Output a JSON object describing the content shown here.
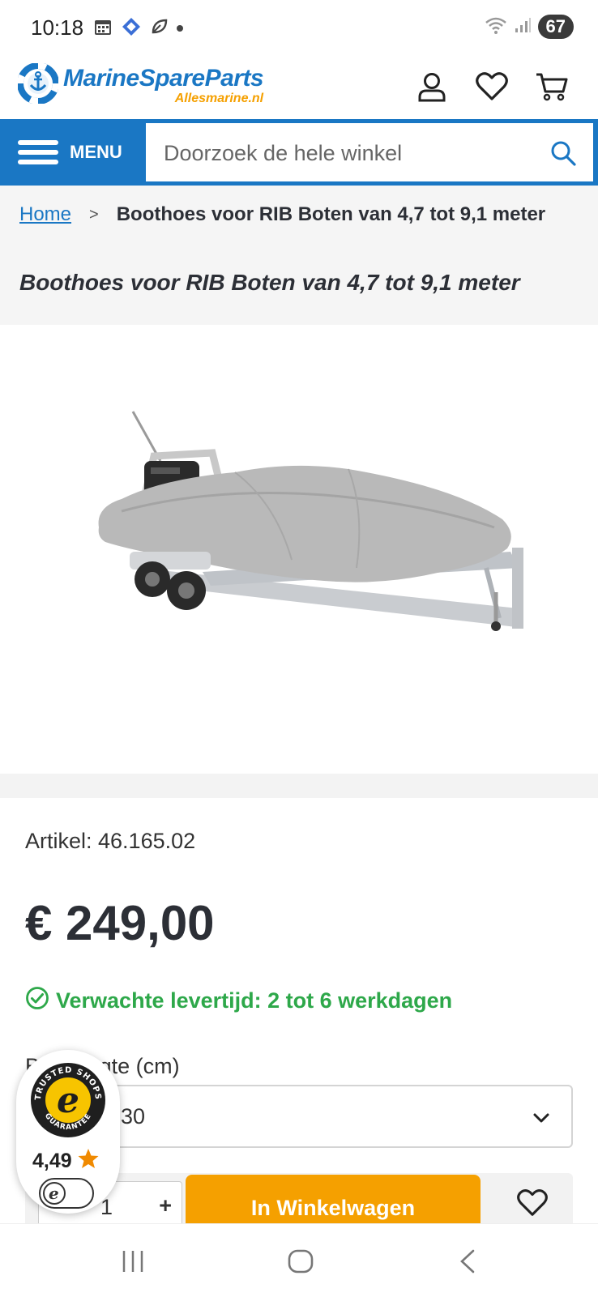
{
  "status_bar": {
    "time": "10:18",
    "battery": "67",
    "icons": [
      "calendar-icon",
      "puzzle-icon",
      "leaf-icon",
      "dot-icon",
      "wifi-icon",
      "signal-icon"
    ]
  },
  "header": {
    "logo_main": "MarineSpareParts",
    "logo_sub": "Allesmarine.nl",
    "icons": [
      "account-icon",
      "wishlist-icon",
      "cart-icon"
    ]
  },
  "nav": {
    "menu_label": "MENU",
    "search_placeholder": "Doorzoek de hele winkel"
  },
  "breadcrumb": {
    "home": "Home",
    "separator": ">",
    "current": "Boothoes voor RIB Boten van 4,7 tot 9,1 meter"
  },
  "product": {
    "title": "Boothoes voor RIB Boten van 4,7 tot 9,1 meter",
    "sku": "Artikel: 46.165.02",
    "price": "€ 249,00",
    "delivery": "Verwachte levertijd: 2 tot 6 werkdagen",
    "option_label": "Bootlengte (cm)",
    "option_value": "30",
    "quantity": "1",
    "qty_plus": "+",
    "add_to_cart": "In Winkelwagen"
  },
  "trusted_shops": {
    "rating": "4,49",
    "seal_top": "TRUSTED SHOPS",
    "seal_bottom": "GUARANTEE",
    "seal_letter": "e"
  },
  "colors": {
    "brand_blue": "#1a77c4",
    "brand_orange": "#f5a000",
    "delivery_green": "#2ea84a"
  }
}
